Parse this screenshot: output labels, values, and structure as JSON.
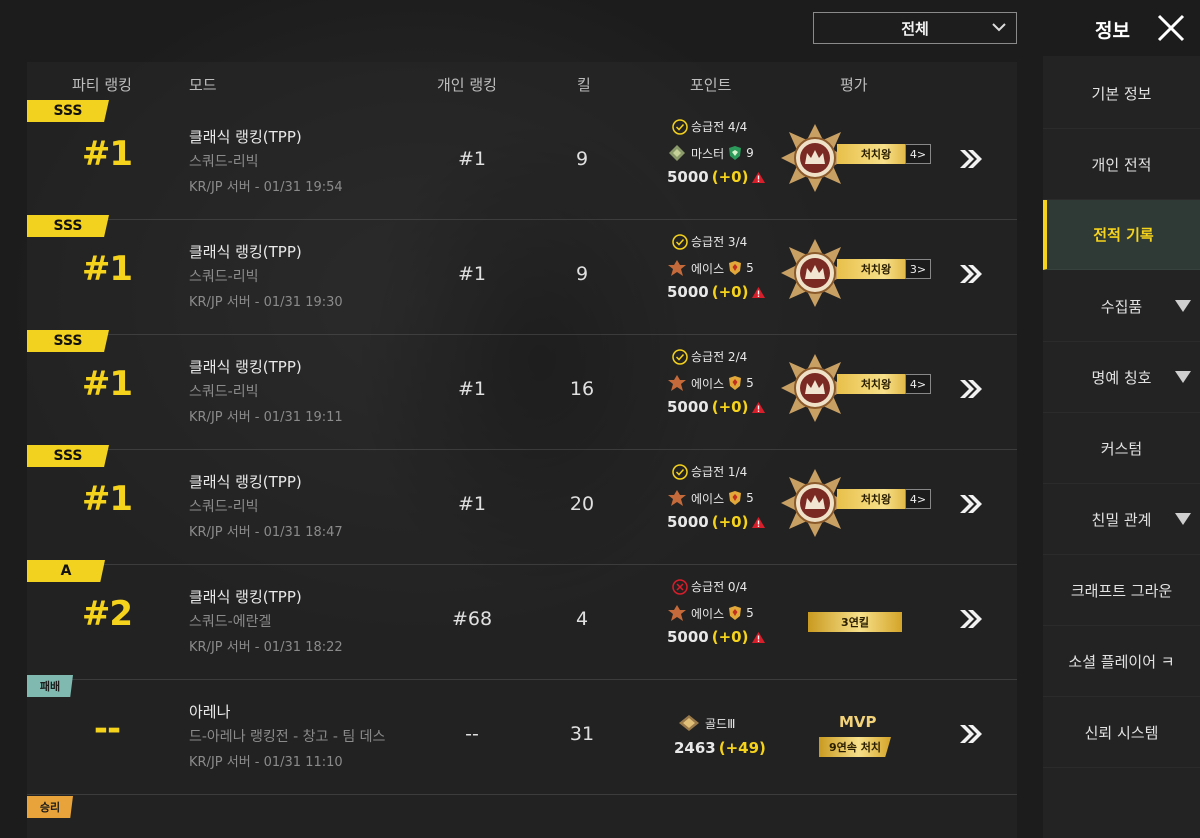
{
  "header": {
    "filter_value": "전체",
    "title": "정보"
  },
  "columns": {
    "party_rank": "파티 랭킹",
    "mode": "모드",
    "personal_rank": "개인 랭킹",
    "kills": "킬",
    "points": "포인트",
    "rating": "평가"
  },
  "rows": [
    {
      "tag": "SSS",
      "rank": "#1",
      "mode": "클래식 랭킹(TPP)",
      "submode": "스쿼드-리빅",
      "server_time": "KR/JP 서버 - 01/31 19:54",
      "personal_rank": "#1",
      "kills": "9",
      "promo": "승급전 4/4",
      "tier": "마스터",
      "tier_level": "9",
      "points": "5000",
      "delta": "(+0)",
      "award": "처치왕",
      "award_count": "4"
    },
    {
      "tag": "SSS",
      "rank": "#1",
      "mode": "클래식 랭킹(TPP)",
      "submode": "스쿼드-리빅",
      "server_time": "KR/JP 서버 - 01/31 19:30",
      "personal_rank": "#1",
      "kills": "9",
      "promo": "승급전 3/4",
      "tier": "에이스",
      "tier_level": "5",
      "points": "5000",
      "delta": "(+0)",
      "award": "처치왕",
      "award_count": "3"
    },
    {
      "tag": "SSS",
      "rank": "#1",
      "mode": "클래식 랭킹(TPP)",
      "submode": "스쿼드-리빅",
      "server_time": "KR/JP 서버 - 01/31 19:11",
      "personal_rank": "#1",
      "kills": "16",
      "promo": "승급전 2/4",
      "tier": "에이스",
      "tier_level": "5",
      "points": "5000",
      "delta": "(+0)",
      "award": "처치왕",
      "award_count": "4"
    },
    {
      "tag": "SSS",
      "rank": "#1",
      "mode": "클래식 랭킹(TPP)",
      "submode": "스쿼드-리빅",
      "server_time": "KR/JP 서버 - 01/31 18:47",
      "personal_rank": "#1",
      "kills": "20",
      "promo": "승급전 1/4",
      "tier": "에이스",
      "tier_level": "5",
      "points": "5000",
      "delta": "(+0)",
      "award": "처치왕",
      "award_count": "4"
    },
    {
      "tag": "A",
      "rank": "#2",
      "mode": "클래식 랭킹(TPP)",
      "submode": "스쿼드-에란겔",
      "server_time": "KR/JP 서버 - 01/31 18:22",
      "personal_rank": "#68",
      "kills": "4",
      "promo": "승급전 0/4",
      "tier": "에이스",
      "tier_level": "5",
      "points": "5000",
      "delta": "(+0)",
      "streak": "3연킬"
    },
    {
      "tag": "패배",
      "rank": "--",
      "mode": "아레나",
      "submode": "드-아레나 랭킹전 - 창고 - 팀 데스",
      "server_time": "KR/JP 서버 - 01/31 11:10",
      "personal_rank": "--",
      "kills": "31",
      "tier": "골드Ⅲ",
      "points": "2463",
      "delta": "(+49)",
      "mvp": "MVP",
      "mvp_badge": "9연속 처치"
    }
  ],
  "next_tag": "승리",
  "sidebar": {
    "items": [
      {
        "label": "기본 정보"
      },
      {
        "label": "개인 전적"
      },
      {
        "label": "전적 기록",
        "active": true
      },
      {
        "label": "수집품"
      },
      {
        "label": "명예 칭호"
      },
      {
        "label": "커스텀"
      },
      {
        "label": "친밀 관계"
      },
      {
        "label": "크래프트 그라운"
      },
      {
        "label": "소셜 플레이어 ㅋ"
      },
      {
        "label": "신뢰 시스템"
      }
    ]
  },
  "colors": {
    "accent_yellow": "#f5d21c",
    "defeat_tag": "#7fb9b0",
    "win_tag": "#e8a43a",
    "warning_red": "#d81e2a"
  }
}
